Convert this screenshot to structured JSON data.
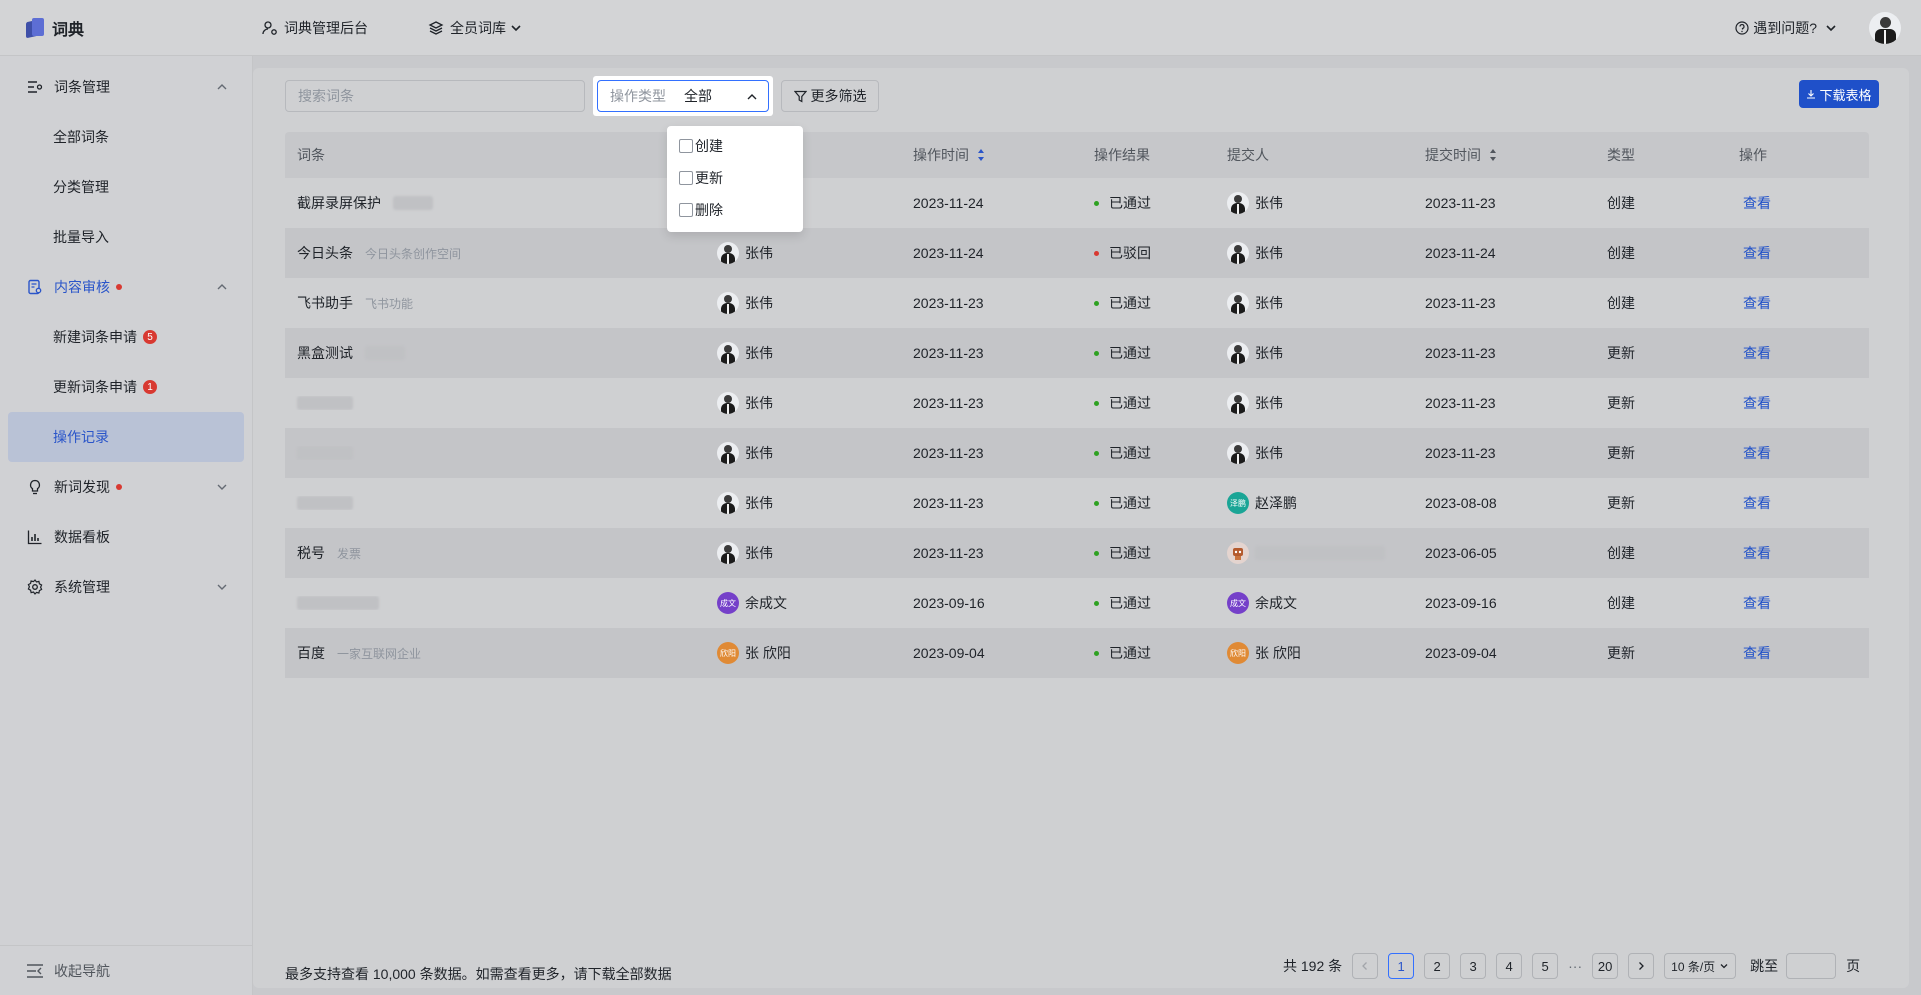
{
  "app": {
    "name": "词典"
  },
  "topnav": {
    "admin": "词典管理后台",
    "library": "全员词库"
  },
  "help": "遇到问题?",
  "sidebar": {
    "groups": [
      {
        "label": "词条管理",
        "icon": "list-settings-icon"
      },
      {
        "label": "内容审核",
        "icon": "document-review-icon"
      },
      {
        "label": "新词发现",
        "icon": "lightbulb-icon"
      },
      {
        "label": "数据看板",
        "icon": "bar-chart-icon"
      },
      {
        "label": "系统管理",
        "icon": "gear-icon"
      }
    ],
    "entries_sub": [
      "全部词条",
      "分类管理",
      "批量导入"
    ],
    "review_sub": [
      {
        "label": "新建词条申请",
        "badge": "5"
      },
      {
        "label": "更新词条申请",
        "badge": "1"
      },
      {
        "label": "操作记录"
      }
    ],
    "collapse": "收起导航"
  },
  "filters": {
    "search_placeholder": "搜索词条",
    "op_type_label": "操作类型",
    "op_type_value": "全部",
    "more_filters": "更多筛选",
    "download": "下载表格",
    "dropdown_options": [
      "创建",
      "更新",
      "删除"
    ]
  },
  "table": {
    "headers": [
      "词条",
      "",
      "操作时间",
      "操作结果",
      "提交人",
      "提交时间",
      "类型",
      "操作"
    ],
    "rows": [
      {
        "term": "截屏录屏保护",
        "desc": "",
        "operator": "",
        "op_time": "2023-11-24",
        "result": "已通过",
        "submitter": "张伟",
        "submit_time": "2023-11-23",
        "type": "创建",
        "action": "查看"
      },
      {
        "term": "今日头条",
        "desc": "今日头条创作空间",
        "operator": "张伟",
        "op_time": "2023-11-24",
        "result": "已驳回",
        "submitter": "张伟",
        "submit_time": "2023-11-24",
        "type": "创建",
        "action": "查看"
      },
      {
        "term": "飞书助手",
        "desc": "飞书功能",
        "operator": "张伟",
        "op_time": "2023-11-23",
        "result": "已通过",
        "submitter": "张伟",
        "submit_time": "2023-11-23",
        "type": "创建",
        "action": "查看"
      },
      {
        "term": "黑盒测试",
        "desc": "",
        "operator": "张伟",
        "op_time": "2023-11-23",
        "result": "已通过",
        "submitter": "张伟",
        "submit_time": "2023-11-23",
        "type": "更新",
        "action": "查看"
      },
      {
        "term": "",
        "desc": "",
        "operator": "张伟",
        "op_time": "2023-11-23",
        "result": "已通过",
        "submitter": "张伟",
        "submit_time": "2023-11-23",
        "type": "更新",
        "action": "查看"
      },
      {
        "term": "",
        "desc": "",
        "operator": "张伟",
        "op_time": "2023-11-23",
        "result": "已通过",
        "submitter": "张伟",
        "submit_time": "2023-11-23",
        "type": "更新",
        "action": "查看"
      },
      {
        "term": "",
        "desc": "",
        "operator": "张伟",
        "op_time": "2023-11-23",
        "result": "已通过",
        "submitter": "赵泽鹏",
        "submitter_avatar": "泽鹏",
        "submit_time": "2023-08-08",
        "type": "更新",
        "action": "查看"
      },
      {
        "term": "税号",
        "desc": "发票",
        "operator": "张伟",
        "op_time": "2023-11-23",
        "result": "已通过",
        "submitter": "",
        "submit_time": "2023-06-05",
        "type": "创建",
        "action": "查看"
      },
      {
        "term": "",
        "desc": "",
        "operator": "余成文",
        "operator_avatar": "成文",
        "op_time": "2023-09-16",
        "result": "已通过",
        "submitter": "余成文",
        "submitter_avatar": "成文",
        "submit_time": "2023-09-16",
        "type": "创建",
        "action": "查看"
      },
      {
        "term": "百度",
        "desc": "一家互联网企业",
        "operator": "张 欣阳",
        "operator_avatar": "欣阳",
        "op_time": "2023-09-04",
        "result": "已通过",
        "submitter": "张 欣阳",
        "submitter_avatar": "欣阳",
        "submit_time": "2023-09-04",
        "type": "更新",
        "action": "查看"
      }
    ]
  },
  "footer": {
    "note": "最多支持查看 10,000 条数据。如需查看更多，请下载全部数据",
    "total": "共 192 条",
    "pages": [
      "1",
      "2",
      "3",
      "4",
      "5"
    ],
    "ellipsis": "···",
    "last_page": "20",
    "page_size": "10 条/页",
    "jump_label": "跳至",
    "page_unit": "页"
  },
  "colors": {
    "accent": "#3370ff",
    "link": "#1f50c9",
    "ok": "#2ea121",
    "reject": "#d83931"
  }
}
